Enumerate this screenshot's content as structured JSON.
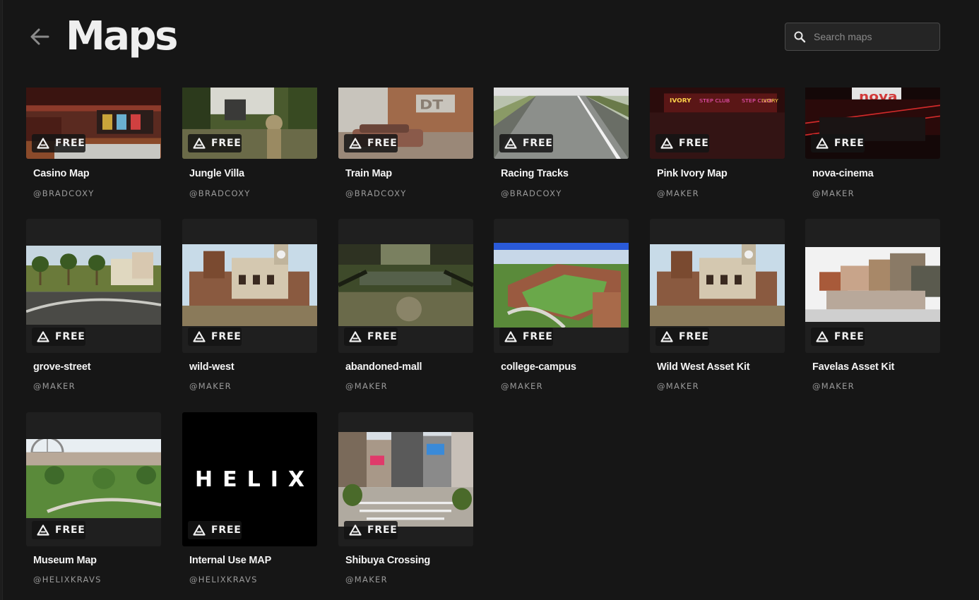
{
  "header": {
    "title": "Maps",
    "search_placeholder": "Search maps"
  },
  "badge_label": "FREE",
  "maps": [
    {
      "name": "Casino Map",
      "author": "@BRADCOXY",
      "price": "FREE",
      "scene": "casino"
    },
    {
      "name": "Jungle Villa",
      "author": "@BRADCOXY",
      "price": "FREE",
      "scene": "jungle"
    },
    {
      "name": "Train Map",
      "author": "@BRADCOXY",
      "price": "FREE",
      "scene": "train"
    },
    {
      "name": "Racing Tracks",
      "author": "@BRADCOXY",
      "price": "FREE",
      "scene": "racing"
    },
    {
      "name": "Pink Ivory Map",
      "author": "@MAKER",
      "price": "FREE",
      "scene": "ivory"
    },
    {
      "name": "nova-cinema",
      "author": "@MAKER",
      "price": "FREE",
      "scene": "nova"
    },
    {
      "name": "grove-street",
      "author": "@MAKER",
      "price": "FREE",
      "scene": "grove"
    },
    {
      "name": "wild-west",
      "author": "@MAKER",
      "price": "FREE",
      "scene": "west"
    },
    {
      "name": "abandoned-mall",
      "author": "@MAKER",
      "price": "FREE",
      "scene": "mall"
    },
    {
      "name": "college-campus",
      "author": "@MAKER",
      "price": "FREE",
      "scene": "campus"
    },
    {
      "name": "Wild West Asset Kit",
      "author": "@MAKER",
      "price": "FREE",
      "scene": "west"
    },
    {
      "name": "Favelas Asset Kit",
      "author": "@MAKER",
      "price": "FREE",
      "scene": "favelas"
    },
    {
      "name": "Museum Map",
      "author": "@HELIXKRAVS",
      "price": "FREE",
      "scene": "museum"
    },
    {
      "name": "Internal Use MAP",
      "author": "@HELIXKRAVS",
      "price": "FREE",
      "scene": "helix",
      "logo_text": "HELIX"
    },
    {
      "name": "Shibuya Crossing",
      "author": "@MAKER",
      "price": "FREE",
      "scene": "shibuya"
    }
  ],
  "colors": {
    "background": "#161616",
    "card": "#1f1f1f",
    "text": "#f3f3f3",
    "muted": "#9a9a9a"
  },
  "icons": {
    "back": "arrow-left-icon",
    "search": "search-icon",
    "badge": "helix-triangle-icon"
  }
}
